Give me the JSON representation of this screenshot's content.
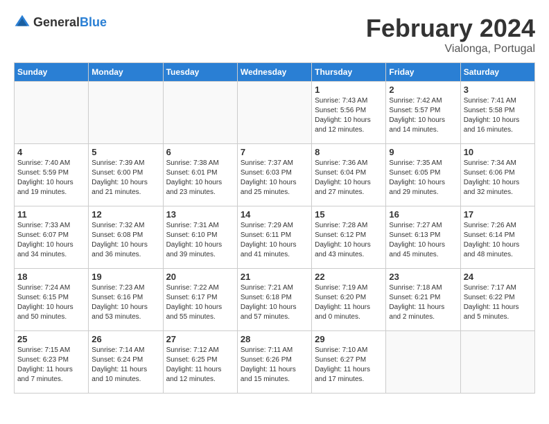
{
  "header": {
    "logo_general": "General",
    "logo_blue": "Blue",
    "title": "February 2024",
    "location": "Vialonga, Portugal"
  },
  "weekdays": [
    "Sunday",
    "Monday",
    "Tuesday",
    "Wednesday",
    "Thursday",
    "Friday",
    "Saturday"
  ],
  "weeks": [
    [
      {
        "day": "",
        "info": ""
      },
      {
        "day": "",
        "info": ""
      },
      {
        "day": "",
        "info": ""
      },
      {
        "day": "",
        "info": ""
      },
      {
        "day": "1",
        "info": "Sunrise: 7:43 AM\nSunset: 5:56 PM\nDaylight: 10 hours\nand 12 minutes."
      },
      {
        "day": "2",
        "info": "Sunrise: 7:42 AM\nSunset: 5:57 PM\nDaylight: 10 hours\nand 14 minutes."
      },
      {
        "day": "3",
        "info": "Sunrise: 7:41 AM\nSunset: 5:58 PM\nDaylight: 10 hours\nand 16 minutes."
      }
    ],
    [
      {
        "day": "4",
        "info": "Sunrise: 7:40 AM\nSunset: 5:59 PM\nDaylight: 10 hours\nand 19 minutes."
      },
      {
        "day": "5",
        "info": "Sunrise: 7:39 AM\nSunset: 6:00 PM\nDaylight: 10 hours\nand 21 minutes."
      },
      {
        "day": "6",
        "info": "Sunrise: 7:38 AM\nSunset: 6:01 PM\nDaylight: 10 hours\nand 23 minutes."
      },
      {
        "day": "7",
        "info": "Sunrise: 7:37 AM\nSunset: 6:03 PM\nDaylight: 10 hours\nand 25 minutes."
      },
      {
        "day": "8",
        "info": "Sunrise: 7:36 AM\nSunset: 6:04 PM\nDaylight: 10 hours\nand 27 minutes."
      },
      {
        "day": "9",
        "info": "Sunrise: 7:35 AM\nSunset: 6:05 PM\nDaylight: 10 hours\nand 29 minutes."
      },
      {
        "day": "10",
        "info": "Sunrise: 7:34 AM\nSunset: 6:06 PM\nDaylight: 10 hours\nand 32 minutes."
      }
    ],
    [
      {
        "day": "11",
        "info": "Sunrise: 7:33 AM\nSunset: 6:07 PM\nDaylight: 10 hours\nand 34 minutes."
      },
      {
        "day": "12",
        "info": "Sunrise: 7:32 AM\nSunset: 6:08 PM\nDaylight: 10 hours\nand 36 minutes."
      },
      {
        "day": "13",
        "info": "Sunrise: 7:31 AM\nSunset: 6:10 PM\nDaylight: 10 hours\nand 39 minutes."
      },
      {
        "day": "14",
        "info": "Sunrise: 7:29 AM\nSunset: 6:11 PM\nDaylight: 10 hours\nand 41 minutes."
      },
      {
        "day": "15",
        "info": "Sunrise: 7:28 AM\nSunset: 6:12 PM\nDaylight: 10 hours\nand 43 minutes."
      },
      {
        "day": "16",
        "info": "Sunrise: 7:27 AM\nSunset: 6:13 PM\nDaylight: 10 hours\nand 45 minutes."
      },
      {
        "day": "17",
        "info": "Sunrise: 7:26 AM\nSunset: 6:14 PM\nDaylight: 10 hours\nand 48 minutes."
      }
    ],
    [
      {
        "day": "18",
        "info": "Sunrise: 7:24 AM\nSunset: 6:15 PM\nDaylight: 10 hours\nand 50 minutes."
      },
      {
        "day": "19",
        "info": "Sunrise: 7:23 AM\nSunset: 6:16 PM\nDaylight: 10 hours\nand 53 minutes."
      },
      {
        "day": "20",
        "info": "Sunrise: 7:22 AM\nSunset: 6:17 PM\nDaylight: 10 hours\nand 55 minutes."
      },
      {
        "day": "21",
        "info": "Sunrise: 7:21 AM\nSunset: 6:18 PM\nDaylight: 10 hours\nand 57 minutes."
      },
      {
        "day": "22",
        "info": "Sunrise: 7:19 AM\nSunset: 6:20 PM\nDaylight: 11 hours\nand 0 minutes."
      },
      {
        "day": "23",
        "info": "Sunrise: 7:18 AM\nSunset: 6:21 PM\nDaylight: 11 hours\nand 2 minutes."
      },
      {
        "day": "24",
        "info": "Sunrise: 7:17 AM\nSunset: 6:22 PM\nDaylight: 11 hours\nand 5 minutes."
      }
    ],
    [
      {
        "day": "25",
        "info": "Sunrise: 7:15 AM\nSunset: 6:23 PM\nDaylight: 11 hours\nand 7 minutes."
      },
      {
        "day": "26",
        "info": "Sunrise: 7:14 AM\nSunset: 6:24 PM\nDaylight: 11 hours\nand 10 minutes."
      },
      {
        "day": "27",
        "info": "Sunrise: 7:12 AM\nSunset: 6:25 PM\nDaylight: 11 hours\nand 12 minutes."
      },
      {
        "day": "28",
        "info": "Sunrise: 7:11 AM\nSunset: 6:26 PM\nDaylight: 11 hours\nand 15 minutes."
      },
      {
        "day": "29",
        "info": "Sunrise: 7:10 AM\nSunset: 6:27 PM\nDaylight: 11 hours\nand 17 minutes."
      },
      {
        "day": "",
        "info": ""
      },
      {
        "day": "",
        "info": ""
      }
    ]
  ]
}
